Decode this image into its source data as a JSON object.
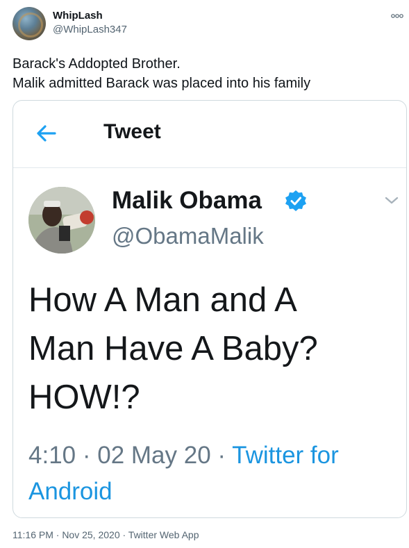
{
  "user": {
    "display_name": "WhipLash",
    "handle": "@WhipLash347"
  },
  "tweet": {
    "lines": [
      "Barack's Addopted Brother.",
      "Malik admitted Barack was placed into his family"
    ],
    "footer": "11:16 PM · Nov 25, 2020 · Twitter Web App"
  },
  "embed": {
    "header": "Tweet",
    "author_name": "Malik Obama",
    "author_handle": "@ObamaMalik",
    "text_lines": [
      "How A Man and A",
      "Man Have A Baby?",
      "HOW!?"
    ],
    "time": "4:10 · 02 May 20 · ",
    "source": "Twitter for Android"
  },
  "colors": {
    "accent": "#1da1f2",
    "link": "#1b95e0",
    "muted": "#657786"
  },
  "icons": {
    "more": "more-options-icon",
    "back": "back-arrow-icon",
    "verified": "verified-badge-icon",
    "chevron": "chevron-down-icon"
  }
}
